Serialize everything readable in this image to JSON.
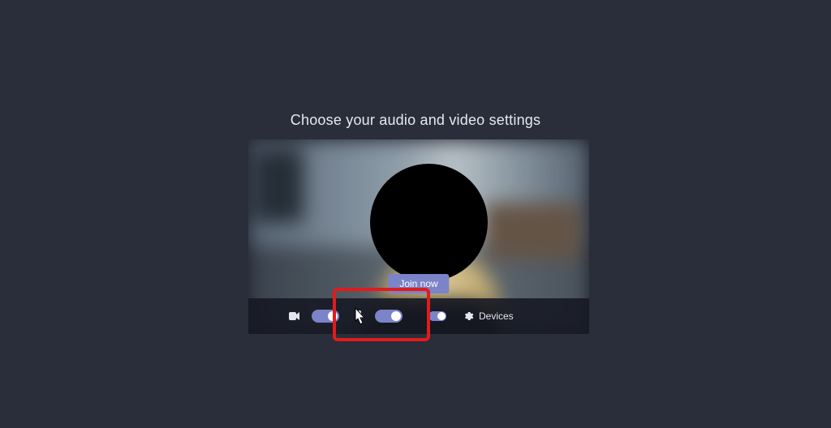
{
  "heading": "Choose your audio and video settings",
  "join_button": "Join now",
  "controls": {
    "camera_icon": "camera-icon",
    "camera_toggle_state": "on",
    "mic_icon": "mic-icon",
    "mic_toggle_state": "on",
    "extra_toggle_state": "on",
    "devices_label": "Devices",
    "settings_icon": "gear-icon"
  },
  "colors": {
    "accent": "#7b83c9",
    "background": "#2a2d3a"
  }
}
